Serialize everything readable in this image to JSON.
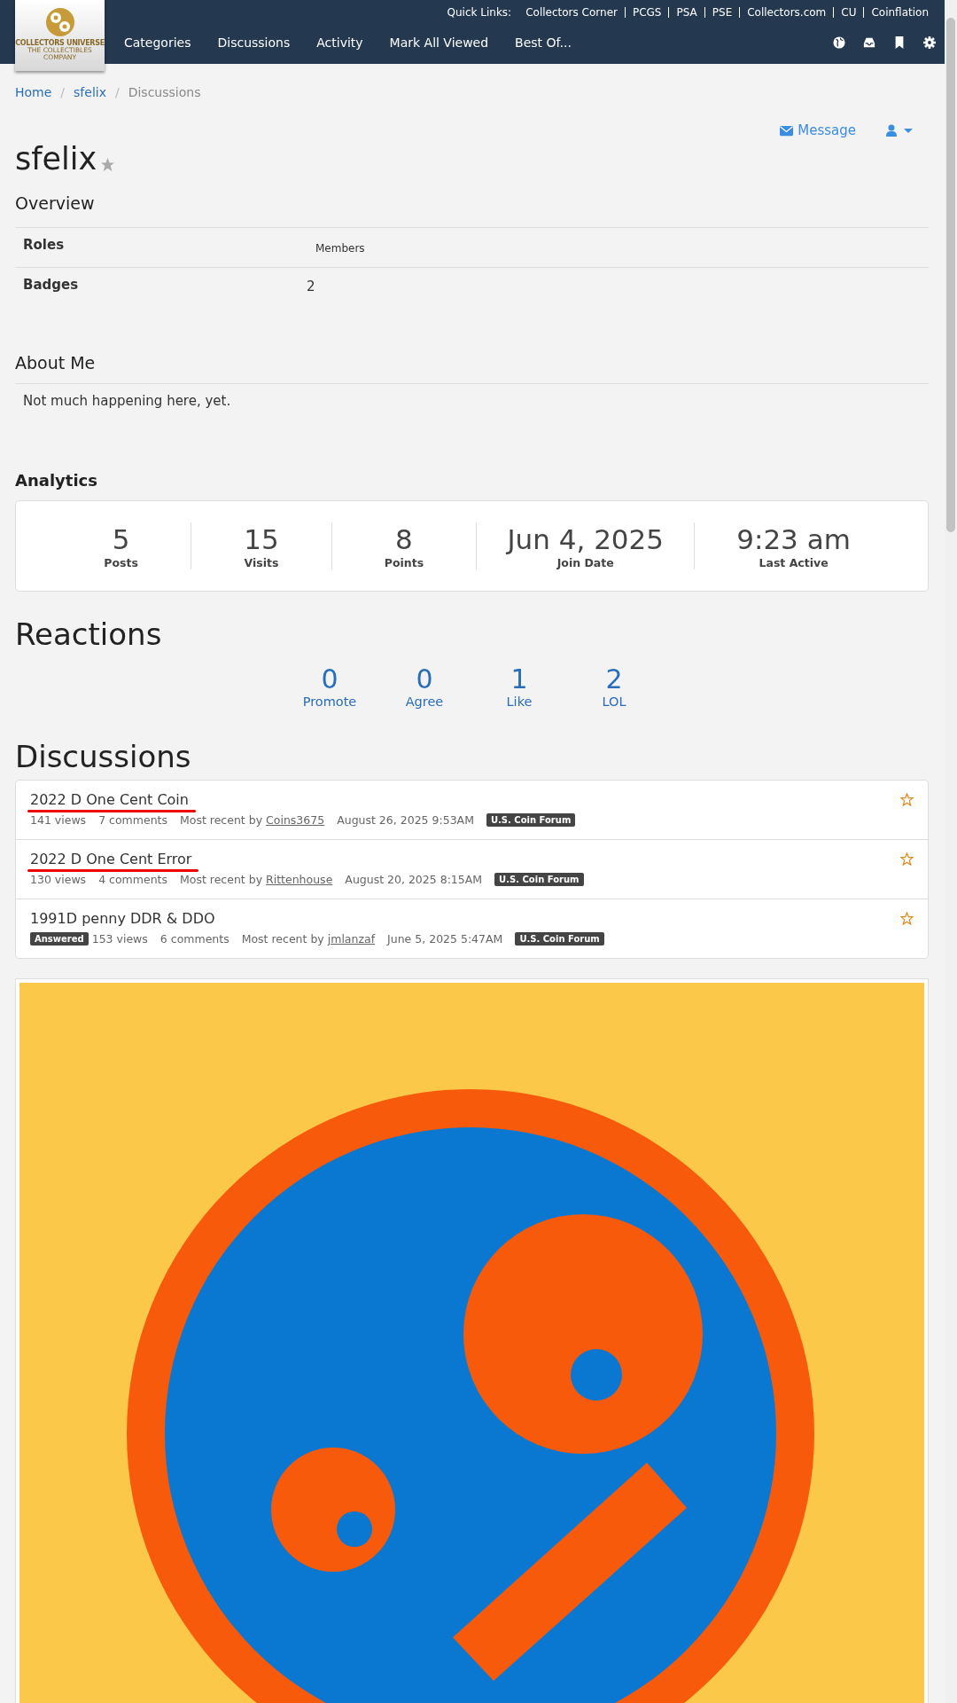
{
  "header": {
    "logo": {
      "title": "COLLECTORS UNIVERSE",
      "tagline": "THE COLLECTIBLES COMPANY"
    },
    "quick_links_label": "Quick Links:",
    "quick_links": [
      "Collectors Corner",
      "PCGS",
      "PSA",
      "PSE",
      "Collectors.com",
      "CU",
      "Coinflation"
    ],
    "nav": [
      "Categories",
      "Discussions",
      "Activity",
      "Mark All Viewed",
      "Best Of..."
    ]
  },
  "breadcrumbs": [
    {
      "label": "Home",
      "kind": "link"
    },
    {
      "label": "/",
      "kind": "separator"
    },
    {
      "label": "sfelix",
      "kind": "link"
    },
    {
      "label": "/",
      "kind": "separator"
    },
    {
      "label": "Discussions",
      "kind": "current"
    }
  ],
  "profile": {
    "name": "sfelix",
    "message_button": "Message"
  },
  "overview": {
    "title": "Overview",
    "rows": [
      {
        "label": "Roles",
        "value": "Members",
        "kind": "small"
      },
      {
        "label": "Badges",
        "value": "2",
        "kind": "normal"
      }
    ]
  },
  "about": {
    "title": "About Me",
    "text": "Not much happening here, yet."
  },
  "analytics": {
    "title": "Analytics",
    "stats": [
      {
        "value": "5",
        "label": "Posts"
      },
      {
        "value": "15",
        "label": "Visits"
      },
      {
        "value": "8",
        "label": "Points"
      },
      {
        "value": "Jun 4, 2025",
        "label": "Join Date"
      },
      {
        "value": "9:23 am",
        "label": "Last Active"
      }
    ]
  },
  "reactions": {
    "title": "Reactions",
    "items": [
      {
        "count": "0",
        "label": "Promote"
      },
      {
        "count": "0",
        "label": "Agree"
      },
      {
        "count": "1",
        "label": "Like"
      },
      {
        "count": "2",
        "label": "LOL"
      }
    ]
  },
  "discussions": {
    "title": "Discussions",
    "items": [
      {
        "title": "2022 D One Cent Coin",
        "marked": true,
        "views": "141 views",
        "comments": "7 comments",
        "recent_label": "Most recent by",
        "recent_user": "Coins3675",
        "date": "August 26, 2025 9:53AM",
        "category": "U.S. Coin Forum",
        "bookmarked": false
      },
      {
        "title": "2022 D One Cent Error",
        "marked": true,
        "views": "130 views",
        "comments": "4 comments",
        "recent_label": "Most recent by",
        "recent_user": "Rittenhouse",
        "date": "August 20, 2025 8:15AM",
        "category": "U.S. Coin Forum",
        "bookmarked": false
      },
      {
        "title": "1991D penny DDR & DDO",
        "marked": false,
        "answered_badge": "Answered",
        "views": "153 views",
        "comments": "6 comments",
        "recent_label": "Most recent by",
        "recent_user": "jmlanzaf",
        "date": "June 5, 2025 5:47AM",
        "category": "U.S. Coin Forum",
        "bookmarked": false
      }
    ]
  }
}
